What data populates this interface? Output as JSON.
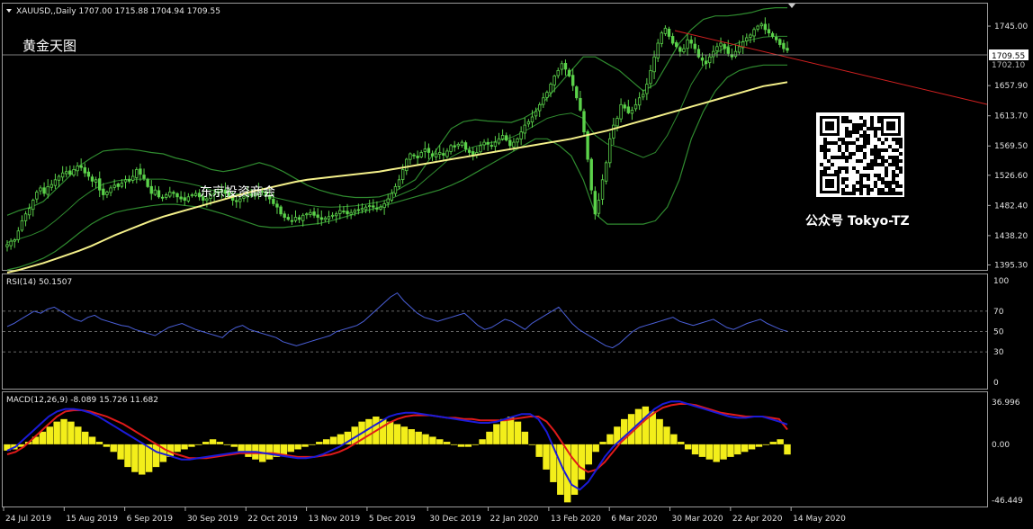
{
  "main": {
    "header": "XAUUSD,,Daily  1707.00 1715.88 1704.94 1709.55",
    "title_cn": "黄金天图",
    "watermark_1": "东京投资商会",
    "watermark_2": "公众号 Tokyo-TZ",
    "current_price": "1709.55",
    "hidden_tick": "1702.10",
    "colors": {
      "background": "#000000",
      "candle": "#5bd24a",
      "bollinger": "#2f8a2f",
      "ma": "#f4f08a",
      "trendline": "#d02020"
    }
  },
  "rsi": {
    "header": "RSI(14) 50.1507",
    "line_color": "#4a5fd8"
  },
  "macd": {
    "header": "MACD(12,26,9) -8.089 15.726 11.682",
    "colors": {
      "histogram": "#f3ee1a",
      "macd": "#1b1bd8",
      "signal": "#e01a1a"
    }
  },
  "chart_data": [
    {
      "type": "candlestick",
      "symbol": "XAUUSD",
      "timeframe": "Daily",
      "ohlc_last": {
        "open": 1707.0,
        "high": 1715.88,
        "low": 1704.94,
        "close": 1709.55
      },
      "y_ticks": [
        "1745.00",
        "1702.10",
        "1657.90",
        "1613.70",
        "1569.50",
        "1526.60",
        "1482.40",
        "1438.20",
        "1395.30"
      ],
      "y_range": [
        1388,
        1778
      ],
      "x_ticks": [
        "24 Jul 2019",
        "15 Aug 2019",
        "6 Sep 2019",
        "30 Sep 2019",
        "22 Oct 2019",
        "13 Nov 2019",
        "5 Dec 2019",
        "30 Dec 2019",
        "22 Jan 2020",
        "13 Feb 2020",
        "6 Mar 2020",
        "30 Mar 2020",
        "22 Apr 2020",
        "14 May 2020"
      ],
      "close_series": [
        1425,
        1430,
        1432,
        1445,
        1460,
        1470,
        1478,
        1490,
        1502,
        1508,
        1500,
        1510,
        1513,
        1520,
        1525,
        1530,
        1532,
        1528,
        1535,
        1540,
        1538,
        1530,
        1525,
        1518,
        1520,
        1505,
        1498,
        1502,
        1508,
        1512,
        1510,
        1515,
        1520,
        1518,
        1525,
        1535,
        1528,
        1522,
        1510,
        1500,
        1505,
        1495,
        1493,
        1498,
        1502,
        1500,
        1495,
        1492,
        1490,
        1495,
        1498,
        1500,
        1495,
        1490,
        1492,
        1498,
        1500,
        1502,
        1505,
        1500,
        1495,
        1490,
        1488,
        1492,
        1495,
        1500,
        1497,
        1500,
        1505,
        1502,
        1498,
        1492,
        1485,
        1480,
        1470,
        1465,
        1462,
        1460,
        1465,
        1462,
        1468,
        1470,
        1472,
        1468,
        1465,
        1462,
        1464,
        1466,
        1468,
        1470,
        1475,
        1473,
        1470,
        1472,
        1475,
        1476,
        1478,
        1480,
        1482,
        1480,
        1478,
        1480,
        1485,
        1492,
        1500,
        1510,
        1520,
        1535,
        1550,
        1558,
        1555,
        1552,
        1560,
        1565,
        1560,
        1555,
        1558,
        1560,
        1556,
        1562,
        1570,
        1568,
        1572,
        1575,
        1565,
        1560,
        1555,
        1560,
        1570,
        1575,
        1572,
        1570,
        1575,
        1580,
        1585,
        1578,
        1570,
        1575,
        1580,
        1590,
        1600,
        1605,
        1612,
        1620,
        1630,
        1640,
        1648,
        1660,
        1672,
        1680,
        1690,
        1682,
        1672,
        1658,
        1640,
        1622,
        1590,
        1550,
        1505,
        1470,
        1490,
        1520,
        1545,
        1580,
        1600,
        1610,
        1630,
        1625,
        1618,
        1622,
        1630,
        1640,
        1645,
        1660,
        1680,
        1700,
        1720,
        1735,
        1742,
        1730,
        1720,
        1715,
        1708,
        1712,
        1725,
        1720,
        1712,
        1700,
        1695,
        1690,
        1700,
        1708,
        1715,
        1720,
        1712,
        1705,
        1700,
        1708,
        1715,
        1722,
        1728,
        1732,
        1740,
        1745,
        1748,
        1740,
        1735,
        1730,
        1725,
        1718,
        1712,
        1709.55
      ],
      "ma_series": [
        1384,
        1388,
        1393,
        1398,
        1404,
        1410,
        1416,
        1423,
        1431,
        1439,
        1446,
        1453,
        1460,
        1466,
        1471,
        1476,
        1481,
        1486,
        1491,
        1496,
        1501,
        1505,
        1509,
        1513,
        1517,
        1520,
        1522,
        1524,
        1526,
        1528,
        1530,
        1532,
        1535,
        1538,
        1541,
        1544,
        1547,
        1550,
        1553,
        1556,
        1559,
        1562,
        1565,
        1568,
        1571,
        1574,
        1577,
        1580,
        1584,
        1588,
        1592,
        1597,
        1602,
        1607,
        1612,
        1617,
        1622,
        1627,
        1632,
        1637,
        1642,
        1647,
        1652,
        1657,
        1660,
        1663
      ],
      "upper_band_series": [
        1468,
        1475,
        1480,
        1488,
        1505,
        1522,
        1540,
        1552,
        1562,
        1564,
        1565,
        1563,
        1560,
        1558,
        1552,
        1548,
        1542,
        1535,
        1532,
        1535,
        1540,
        1545,
        1540,
        1532,
        1522,
        1512,
        1505,
        1500,
        1496,
        1494,
        1494,
        1495,
        1500,
        1510,
        1520,
        1545,
        1570,
        1595,
        1605,
        1608,
        1606,
        1605,
        1604,
        1610,
        1620,
        1640,
        1660,
        1680,
        1700,
        1700,
        1690,
        1680,
        1665,
        1650,
        1660,
        1690,
        1720,
        1740,
        1755,
        1760,
        1760,
        1762,
        1765,
        1770,
        1772,
        1772
      ],
      "lower_band_series": [
        1388,
        1392,
        1398,
        1405,
        1415,
        1428,
        1442,
        1455,
        1465,
        1472,
        1476,
        1479,
        1482,
        1484,
        1484,
        1482,
        1480,
        1475,
        1470,
        1464,
        1458,
        1452,
        1450,
        1450,
        1452,
        1454,
        1456,
        1460,
        1465,
        1470,
        1475,
        1480,
        1485,
        1490,
        1495,
        1500,
        1505,
        1512,
        1520,
        1530,
        1540,
        1550,
        1560,
        1570,
        1580,
        1580,
        1570,
        1555,
        1520,
        1470,
        1455,
        1455,
        1455,
        1455,
        1460,
        1480,
        1520,
        1580,
        1620,
        1650,
        1670,
        1680,
        1685,
        1688,
        1688,
        1688
      ]
    },
    {
      "type": "line",
      "name": "RSI(14)",
      "last_value": 50.1507,
      "y_range": [
        0,
        100
      ],
      "y_ticks": [
        100,
        70,
        50,
        30,
        0
      ],
      "levels": [
        70,
        50,
        30
      ],
      "values": [
        55,
        58,
        62,
        66,
        70,
        68,
        72,
        74,
        70,
        66,
        62,
        60,
        64,
        66,
        62,
        60,
        58,
        56,
        55,
        52,
        50,
        48,
        46,
        50,
        54,
        56,
        58,
        55,
        52,
        50,
        48,
        46,
        44,
        50,
        54,
        56,
        52,
        50,
        48,
        46,
        44,
        40,
        38,
        36,
        38,
        40,
        42,
        44,
        46,
        50,
        52,
        54,
        56,
        60,
        66,
        72,
        78,
        84,
        88,
        80,
        74,
        68,
        64,
        62,
        60,
        62,
        64,
        66,
        68,
        62,
        56,
        52,
        54,
        58,
        62,
        60,
        56,
        52,
        58,
        62,
        66,
        70,
        74,
        66,
        58,
        52,
        48,
        44,
        40,
        36,
        34,
        38,
        44,
        50,
        54,
        56,
        58,
        60,
        62,
        64,
        60,
        58,
        56,
        58,
        60,
        62,
        58,
        54,
        52,
        55,
        58,
        60,
        62,
        58,
        55,
        52,
        50.15
      ]
    },
    {
      "type": "bar+line",
      "name": "MACD(12,26,9)",
      "values_printed": [
        -8.089,
        15.726,
        11.682
      ],
      "y_range": [
        -46.449,
        36.996
      ],
      "y_ticks": [
        36.996,
        0.0,
        -46.449
      ],
      "histogram": [
        -5,
        -4,
        -2,
        2,
        6,
        10,
        14,
        18,
        20,
        18,
        14,
        10,
        6,
        2,
        -2,
        -6,
        -12,
        -18,
        -22,
        -24,
        -22,
        -18,
        -14,
        -10,
        -6,
        -4,
        -2,
        0,
        2,
        4,
        2,
        0,
        -2,
        -6,
        -10,
        -12,
        -14,
        -12,
        -10,
        -8,
        -6,
        -4,
        -2,
        0,
        2,
        4,
        6,
        8,
        10,
        14,
        18,
        20,
        22,
        20,
        18,
        16,
        14,
        12,
        10,
        8,
        6,
        4,
        2,
        0,
        -2,
        -2,
        0,
        4,
        10,
        16,
        20,
        22,
        18,
        10,
        0,
        -10,
        -20,
        -30,
        -40,
        -46,
        -40,
        -28,
        -16,
        -6,
        2,
        8,
        14,
        20,
        24,
        28,
        30,
        26,
        20,
        14,
        8,
        2,
        -4,
        -8,
        -10,
        -12,
        -14,
        -12,
        -10,
        -8,
        -6,
        -4,
        -2,
        0,
        2,
        4,
        -8.089
      ],
      "macd": [
        -5,
        -2,
        4,
        10,
        16,
        22,
        26,
        28,
        28,
        27,
        25,
        22,
        18,
        14,
        10,
        6,
        2,
        -2,
        -6,
        -8,
        -10,
        -12,
        -12,
        -11,
        -10,
        -9,
        -8,
        -7,
        -6,
        -6,
        -6,
        -7,
        -8,
        -9,
        -10,
        -11,
        -11,
        -10,
        -8,
        -5,
        -2,
        2,
        6,
        10,
        14,
        18,
        22,
        24,
        25,
        25,
        24,
        23,
        22,
        21,
        20,
        19,
        18,
        17,
        17,
        18,
        20,
        22,
        24,
        24,
        20,
        10,
        -5,
        -20,
        -32,
        -36,
        -30,
        -20,
        -10,
        -2,
        4,
        10,
        16,
        22,
        28,
        32,
        34,
        34,
        32,
        30,
        28,
        26,
        24,
        22,
        21,
        21,
        22,
        22,
        20,
        18,
        15.726
      ],
      "signal": [
        -8,
        -6,
        -2,
        4,
        10,
        16,
        22,
        26,
        27,
        27,
        26,
        24,
        22,
        19,
        16,
        12,
        8,
        4,
        0,
        -4,
        -7,
        -9,
        -11,
        -11,
        -11,
        -10,
        -9,
        -8,
        -7,
        -7,
        -7,
        -7,
        -7,
        -8,
        -9,
        -10,
        -10,
        -10,
        -9,
        -8,
        -6,
        -3,
        1,
        5,
        9,
        13,
        17,
        20,
        22,
        23,
        23,
        23,
        22,
        21,
        21,
        20,
        20,
        19,
        19,
        19,
        19,
        20,
        21,
        22,
        22,
        18,
        10,
        0,
        -10,
        -18,
        -22,
        -20,
        -14,
        -6,
        2,
        8,
        14,
        20,
        25,
        29,
        31,
        32,
        32,
        31,
        29,
        27,
        25,
        24,
        23,
        22,
        22,
        22,
        21,
        20,
        11.682
      ]
    }
  ]
}
